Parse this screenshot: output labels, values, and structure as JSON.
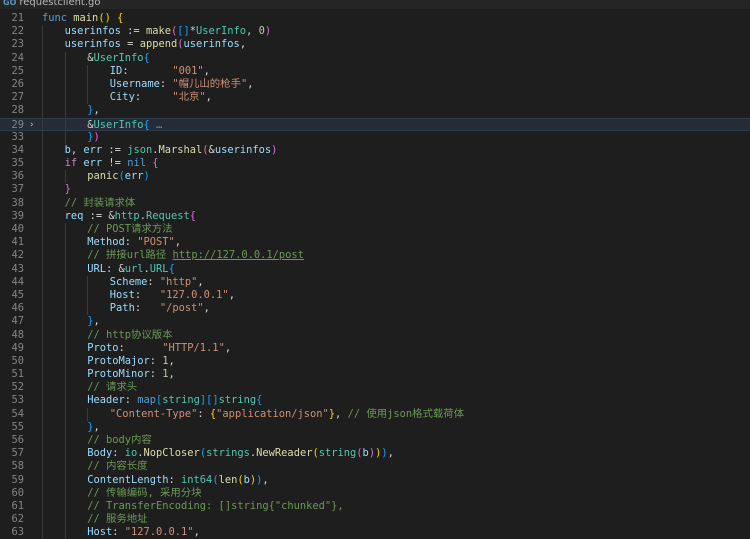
{
  "tab": {
    "icon": "go-file-icon",
    "label": "requestclient.go"
  },
  "lines": [
    {
      "n": "21",
      "indent": 0,
      "tokens": [
        [
          "k",
          "func "
        ],
        [
          "f",
          "main"
        ],
        [
          "b1",
          "()"
        ],
        [
          "p",
          " "
        ],
        [
          "b1",
          "{"
        ]
      ]
    },
    {
      "n": "22",
      "indent": 1,
      "tokens": [
        [
          "v",
          "userinfos"
        ],
        [
          "p",
          " := "
        ],
        [
          "f",
          "make"
        ],
        [
          "b2",
          "("
        ],
        [
          "b3",
          "[]"
        ],
        [
          "p",
          "*"
        ],
        [
          "t",
          "UserInfo"
        ],
        [
          "p",
          ", "
        ],
        [
          "n",
          "0"
        ],
        [
          "b2",
          ")"
        ]
      ]
    },
    {
      "n": "23",
      "indent": 1,
      "tokens": [
        [
          "v",
          "userinfos"
        ],
        [
          "p",
          " = "
        ],
        [
          "f",
          "append"
        ],
        [
          "b2",
          "("
        ],
        [
          "v",
          "userinfos"
        ],
        [
          "p",
          ","
        ]
      ]
    },
    {
      "n": "24",
      "indent": 2,
      "tokens": [
        [
          "p",
          "&"
        ],
        [
          "t",
          "UserInfo"
        ],
        [
          "b3",
          "{"
        ]
      ]
    },
    {
      "n": "25",
      "indent": 3,
      "tokens": [
        [
          "v",
          "ID"
        ],
        [
          "p",
          ":       "
        ],
        [
          "s",
          "\"001\""
        ],
        [
          "p",
          ","
        ]
      ]
    },
    {
      "n": "26",
      "indent": 3,
      "tokens": [
        [
          "v",
          "Username"
        ],
        [
          "p",
          ": "
        ],
        [
          "s",
          "\"帽儿山的枪手\""
        ],
        [
          "p",
          ","
        ]
      ]
    },
    {
      "n": "27",
      "indent": 3,
      "tokens": [
        [
          "v",
          "City"
        ],
        [
          "p",
          ":     "
        ],
        [
          "s",
          "\"北京\""
        ],
        [
          "p",
          ","
        ]
      ]
    },
    {
      "n": "28",
      "indent": 2,
      "tokens": [
        [
          "b3",
          "}"
        ],
        [
          "p",
          ","
        ]
      ]
    },
    {
      "n": "29",
      "indent": 2,
      "fold": true,
      "highlight": true,
      "tokens": [
        [
          "p",
          "&"
        ],
        [
          "t",
          "UserInfo"
        ],
        [
          "b3",
          "{"
        ],
        [
          "fd",
          " …"
        ]
      ]
    },
    {
      "n": "33",
      "indent": 2,
      "tokens": [
        [
          "b3",
          "}"
        ],
        [
          "b2",
          ")"
        ]
      ]
    },
    {
      "n": "34",
      "indent": 1,
      "tokens": [
        [
          "v",
          "b"
        ],
        [
          "p",
          ", "
        ],
        [
          "v",
          "err"
        ],
        [
          "p",
          " := "
        ],
        [
          "t",
          "json"
        ],
        [
          "p",
          "."
        ],
        [
          "f",
          "Marshal"
        ],
        [
          "b2",
          "("
        ],
        [
          "p",
          "&"
        ],
        [
          "v",
          "userinfos"
        ],
        [
          "b2",
          ")"
        ]
      ]
    },
    {
      "n": "35",
      "indent": 1,
      "tokens": [
        [
          "kc",
          "if "
        ],
        [
          "v",
          "err"
        ],
        [
          "p",
          " != "
        ],
        [
          "k",
          "nil"
        ],
        [
          "p",
          " "
        ],
        [
          "b2",
          "{"
        ]
      ]
    },
    {
      "n": "36",
      "indent": 2,
      "tokens": [
        [
          "f",
          "panic"
        ],
        [
          "b3",
          "("
        ],
        [
          "v",
          "err"
        ],
        [
          "b3",
          ")"
        ]
      ]
    },
    {
      "n": "37",
      "indent": 1,
      "tokens": [
        [
          "b2",
          "}"
        ]
      ]
    },
    {
      "n": "38",
      "indent": 1,
      "tokens": [
        [
          "c",
          "// 封装请求体"
        ]
      ]
    },
    {
      "n": "39",
      "indent": 1,
      "tokens": [
        [
          "v",
          "req"
        ],
        [
          "p",
          " := &"
        ],
        [
          "t",
          "http"
        ],
        [
          "p",
          "."
        ],
        [
          "t",
          "Request"
        ],
        [
          "b2",
          "{"
        ]
      ]
    },
    {
      "n": "40",
      "indent": 2,
      "tokens": [
        [
          "c",
          "// POST请求方法"
        ]
      ]
    },
    {
      "n": "41",
      "indent": 2,
      "tokens": [
        [
          "v",
          "Method"
        ],
        [
          "p",
          ": "
        ],
        [
          "s",
          "\"POST\""
        ],
        [
          "p",
          ","
        ]
      ]
    },
    {
      "n": "42",
      "indent": 2,
      "tokens": [
        [
          "c",
          "// 拼接url路径 "
        ],
        [
          "cu",
          "http://127.0.0.1/post"
        ]
      ]
    },
    {
      "n": "43",
      "indent": 2,
      "tokens": [
        [
          "v",
          "URL"
        ],
        [
          "p",
          ": &"
        ],
        [
          "t",
          "url"
        ],
        [
          "p",
          "."
        ],
        [
          "t",
          "URL"
        ],
        [
          "b3",
          "{"
        ]
      ]
    },
    {
      "n": "44",
      "indent": 3,
      "tokens": [
        [
          "v",
          "Scheme"
        ],
        [
          "p",
          ": "
        ],
        [
          "s",
          "\"http\""
        ],
        [
          "p",
          ","
        ]
      ]
    },
    {
      "n": "45",
      "indent": 3,
      "tokens": [
        [
          "v",
          "Host"
        ],
        [
          "p",
          ":   "
        ],
        [
          "s",
          "\"127.0.0.1\""
        ],
        [
          "p",
          ","
        ]
      ]
    },
    {
      "n": "46",
      "indent": 3,
      "tokens": [
        [
          "v",
          "Path"
        ],
        [
          "p",
          ":   "
        ],
        [
          "s",
          "\"/post\""
        ],
        [
          "p",
          ","
        ]
      ]
    },
    {
      "n": "47",
      "indent": 2,
      "tokens": [
        [
          "b3",
          "}"
        ],
        [
          "p",
          ","
        ]
      ]
    },
    {
      "n": "48",
      "indent": 2,
      "tokens": [
        [
          "c",
          "// http协议版本"
        ]
      ]
    },
    {
      "n": "49",
      "indent": 2,
      "tokens": [
        [
          "v",
          "Proto"
        ],
        [
          "p",
          ":      "
        ],
        [
          "s",
          "\"HTTP/1.1\""
        ],
        [
          "p",
          ","
        ]
      ]
    },
    {
      "n": "50",
      "indent": 2,
      "tokens": [
        [
          "v",
          "ProtoMajor"
        ],
        [
          "p",
          ": "
        ],
        [
          "n",
          "1"
        ],
        [
          "p",
          ","
        ]
      ]
    },
    {
      "n": "51",
      "indent": 2,
      "tokens": [
        [
          "v",
          "ProtoMinor"
        ],
        [
          "p",
          ": "
        ],
        [
          "n",
          "1"
        ],
        [
          "p",
          ","
        ]
      ]
    },
    {
      "n": "52",
      "indent": 2,
      "tokens": [
        [
          "c",
          "// 请求头"
        ]
      ]
    },
    {
      "n": "53",
      "indent": 2,
      "tokens": [
        [
          "v",
          "Header"
        ],
        [
          "p",
          ": "
        ],
        [
          "k",
          "map"
        ],
        [
          "b3",
          "["
        ],
        [
          "t",
          "string"
        ],
        [
          "b3",
          "][]"
        ],
        [
          "t",
          "string"
        ],
        [
          "b3",
          "{"
        ]
      ]
    },
    {
      "n": "54",
      "indent": 3,
      "tokens": [
        [
          "s",
          "\"Content-Type\""
        ],
        [
          "p",
          ": "
        ],
        [
          "b1",
          "{"
        ],
        [
          "s",
          "\"application/json\""
        ],
        [
          "b1",
          "}"
        ],
        [
          "p",
          ", "
        ],
        [
          "c",
          "// 使用json格式载荷体"
        ]
      ]
    },
    {
      "n": "55",
      "indent": 2,
      "tokens": [
        [
          "b3",
          "}"
        ],
        [
          "p",
          ","
        ]
      ]
    },
    {
      "n": "56",
      "indent": 2,
      "tokens": [
        [
          "c",
          "// body内容"
        ]
      ]
    },
    {
      "n": "57",
      "indent": 2,
      "tokens": [
        [
          "v",
          "Body"
        ],
        [
          "p",
          ": "
        ],
        [
          "t",
          "io"
        ],
        [
          "p",
          "."
        ],
        [
          "f",
          "NopCloser"
        ],
        [
          "b3",
          "("
        ],
        [
          "t",
          "strings"
        ],
        [
          "p",
          "."
        ],
        [
          "f",
          "NewReader"
        ],
        [
          "b1",
          "("
        ],
        [
          "t",
          "string"
        ],
        [
          "b2",
          "("
        ],
        [
          "v",
          "b"
        ],
        [
          "b2",
          ")"
        ],
        [
          "b1",
          ")"
        ],
        [
          "b3",
          ")"
        ],
        [
          "p",
          ","
        ]
      ]
    },
    {
      "n": "58",
      "indent": 2,
      "tokens": [
        [
          "c",
          "// 内容长度"
        ]
      ]
    },
    {
      "n": "59",
      "indent": 2,
      "tokens": [
        [
          "v",
          "ContentLength"
        ],
        [
          "p",
          ": "
        ],
        [
          "t",
          "int64"
        ],
        [
          "b3",
          "("
        ],
        [
          "f",
          "len"
        ],
        [
          "b1",
          "("
        ],
        [
          "v",
          "b"
        ],
        [
          "b1",
          ")"
        ],
        [
          "b3",
          ")"
        ],
        [
          "p",
          ","
        ]
      ]
    },
    {
      "n": "60",
      "indent": 2,
      "tokens": [
        [
          "c",
          "// 传输编码, 采用分块"
        ]
      ]
    },
    {
      "n": "61",
      "indent": 2,
      "tokens": [
        [
          "c",
          "// TransferEncoding: []string{\"chunked\"},"
        ]
      ]
    },
    {
      "n": "62",
      "indent": 2,
      "tokens": [
        [
          "c",
          "// 服务地址"
        ]
      ]
    },
    {
      "n": "63",
      "indent": 2,
      "tokens": [
        [
          "v",
          "Host"
        ],
        [
          "p",
          ": "
        ],
        [
          "s",
          "\"127.0.0.1\""
        ],
        [
          "p",
          ","
        ]
      ]
    }
  ]
}
